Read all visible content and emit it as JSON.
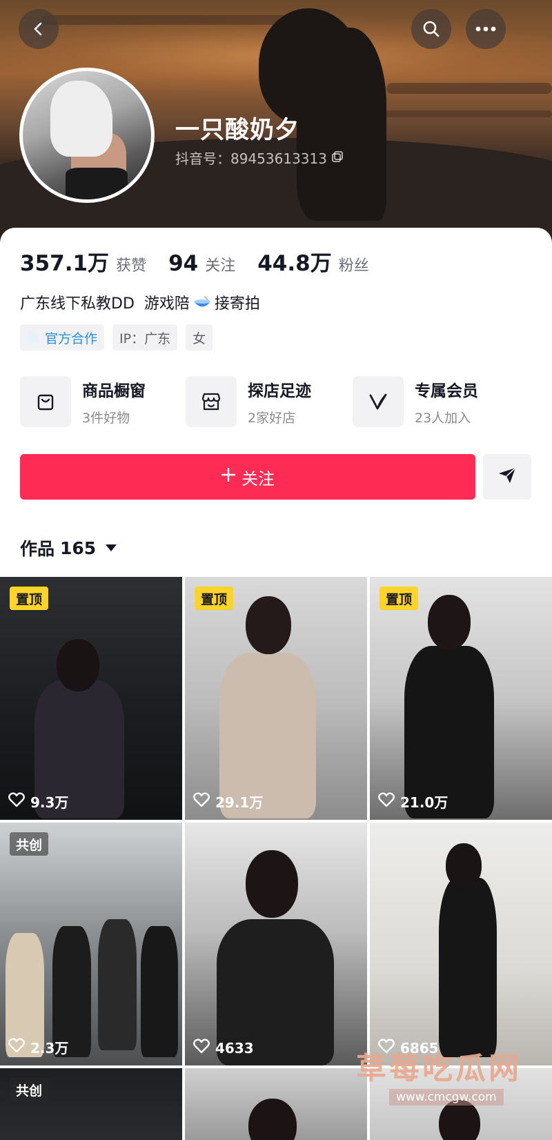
{
  "header": {
    "nickname": "一只酸奶夕",
    "douyin_id": "抖音号：89453613313"
  },
  "stats": [
    {
      "value": "357.1万",
      "label": "获赞"
    },
    {
      "value": "94",
      "label": "关注"
    },
    {
      "value": "44.8万",
      "label": "粉丝"
    }
  ],
  "bio": {
    "text_before": "广东线下私教DD  游戏陪",
    "emoji": "bowl-with-spoon",
    "text_after": "接寄拍"
  },
  "tags": [
    "官方合作",
    "IP：广东",
    "女"
  ],
  "features": [
    {
      "title": "商品橱窗",
      "sub": "3件好物",
      "icon": "shopping-bag-icon"
    },
    {
      "title": "探店足迹",
      "sub": "2家好店",
      "icon": "store-icon"
    },
    {
      "title": "专属会员",
      "sub": "23人加入",
      "icon": "member-v-icon"
    }
  ],
  "actions": {
    "follow_label": "关注",
    "follow_color": "#fe2c55"
  },
  "works": {
    "label": "作品",
    "count": "165"
  },
  "videos": [
    {
      "badge": "置顶",
      "likes": "9.3万"
    },
    {
      "badge": "置顶",
      "likes": "29.1万"
    },
    {
      "badge": "置顶",
      "likes": "21.0万"
    },
    {
      "badge": "共创",
      "likes": "2.3万"
    },
    {
      "badge": "",
      "likes": "4633"
    },
    {
      "badge": "",
      "likes": "6865"
    },
    {
      "badge": "共创",
      "likes": ""
    },
    {
      "badge": "",
      "likes": ""
    },
    {
      "badge": "",
      "likes": ""
    }
  ],
  "watermark": {
    "title": "草莓吃瓜网",
    "url": "www.cmcgw.com"
  },
  "colors": {
    "accent": "#fe2c55",
    "pin_badge": "#ffd42a",
    "official_tag": "#2f8fd6"
  }
}
